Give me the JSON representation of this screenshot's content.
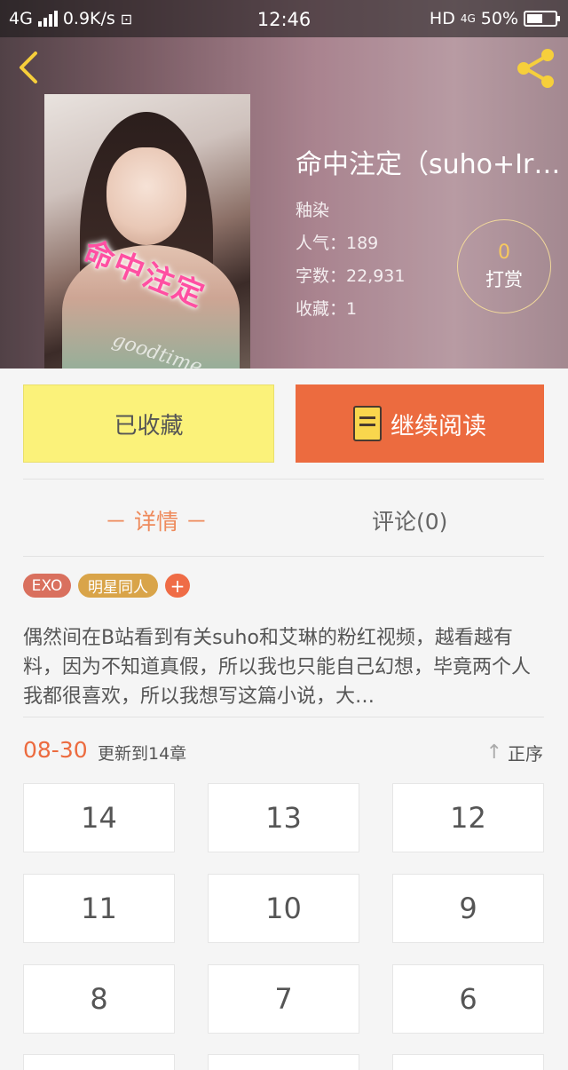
{
  "status_bar": {
    "network": "4G",
    "speed": "0.9K/s",
    "time": "12:46",
    "hd_label": "HD",
    "net_badge": "4G",
    "battery": "50%"
  },
  "book": {
    "title": "命中注定（suho+Ir…",
    "author": "釉染",
    "popularity": "人气：189",
    "word_count": "字数：22,931",
    "favorites": "收藏：1",
    "cover_title": "命中注定",
    "cover_script": "goodtime"
  },
  "reward": {
    "count": "0",
    "label": "打赏"
  },
  "buttons": {
    "favorited": "已收藏",
    "continue_reading": "继续阅读"
  },
  "tabs": {
    "detail": "－ 详情 －",
    "comments": "评论(0)"
  },
  "tags": {
    "exo": "EXO",
    "star": "明星同人",
    "add": "+"
  },
  "summary": "偶然间在B站看到有关suho和艾琳的粉红视频，越看越有料，因为不知道真假，所以我也只能自己幻想，毕竟两个人我都很喜欢，所以我想写这篇小说，大…",
  "update": {
    "date": "08-30",
    "text": "更新到14章",
    "sort_label": "正序",
    "sort_icon": "↑"
  },
  "chapters": [
    "14",
    "13",
    "12",
    "11",
    "10",
    "9",
    "8",
    "7",
    "6"
  ],
  "colors": {
    "accent": "#ec6b3f",
    "favorite_bg": "#fbf27a",
    "reward_ring": "#f1d89b"
  }
}
